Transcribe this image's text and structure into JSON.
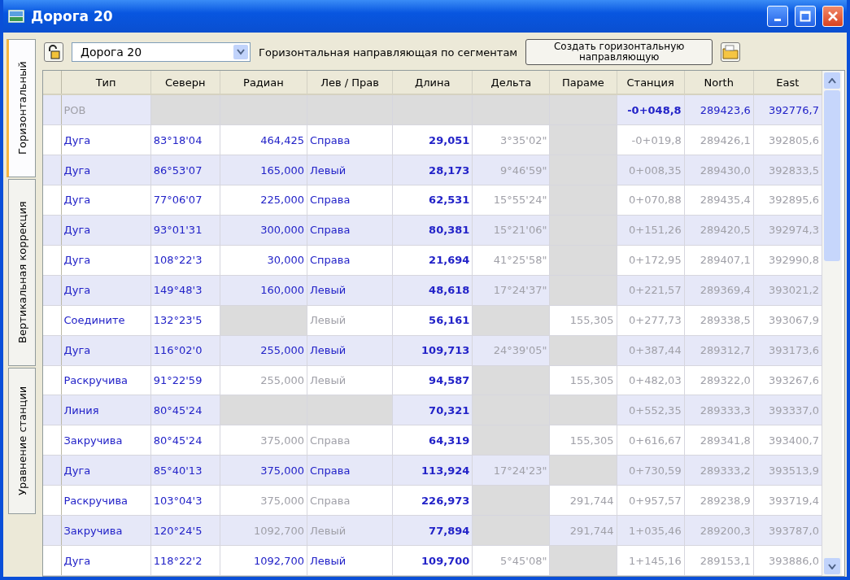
{
  "window": {
    "title": "Дорога 20"
  },
  "side_tabs": [
    {
      "label": "Горизонтальный",
      "selected": true
    },
    {
      "label": "Вертикальная коррекция",
      "selected": false
    },
    {
      "label": "Уравнение станции",
      "selected": false
    }
  ],
  "toolbar": {
    "alignment": {
      "value": "Дорога 20"
    },
    "label": "Горизонтальная направляющая по сегментам",
    "create_button": "Создать горизонтальную направляющую"
  },
  "table": {
    "columns": [
      {
        "label": "Тип"
      },
      {
        "label": "Северн"
      },
      {
        "label": "Радиан"
      },
      {
        "label": "Лев / Прав"
      },
      {
        "label": "Длина"
      },
      {
        "label": "Дельта"
      },
      {
        "label": "Параме"
      },
      {
        "label": "Станция"
      },
      {
        "label": "North"
      },
      {
        "label": "East"
      }
    ],
    "rows": [
      [
        {
          "text": "РОВ",
          "kind": "output"
        },
        {
          "kind": "blank"
        },
        {
          "kind": "blank"
        },
        {
          "kind": "blank"
        },
        {
          "kind": "blank"
        },
        {
          "kind": "blank"
        },
        {
          "kind": "blank"
        },
        {
          "text": "-0+048,8",
          "kind": "input"
        },
        {
          "text": "289423,6",
          "kind": "input"
        },
        {
          "text": "392776,7",
          "kind": "input"
        }
      ],
      [
        {
          "text": "Дуга",
          "kind": "input"
        },
        {
          "text": "83°18'04",
          "kind": "input"
        },
        {
          "text": "464,425",
          "kind": "input"
        },
        {
          "text": "Справа",
          "kind": "input"
        },
        {
          "text": "29,051",
          "kind": "input"
        },
        {
          "text": "3°35'02\"",
          "kind": "output"
        },
        {
          "kind": "blank"
        },
        {
          "text": "-0+019,8",
          "kind": "output"
        },
        {
          "text": "289426,1",
          "kind": "output"
        },
        {
          "text": "392805,6",
          "kind": "output"
        }
      ],
      [
        {
          "text": "Дуга",
          "kind": "input"
        },
        {
          "text": "86°53'07",
          "kind": "input"
        },
        {
          "text": "165,000",
          "kind": "input"
        },
        {
          "text": "Левый",
          "kind": "input"
        },
        {
          "text": "28,173",
          "kind": "input"
        },
        {
          "text": "9°46'59\"",
          "kind": "output"
        },
        {
          "kind": "blank"
        },
        {
          "text": "0+008,35",
          "kind": "output"
        },
        {
          "text": "289430,0",
          "kind": "output"
        },
        {
          "text": "392833,5",
          "kind": "output"
        }
      ],
      [
        {
          "text": "Дуга",
          "kind": "input"
        },
        {
          "text": "77°06'07",
          "kind": "input"
        },
        {
          "text": "225,000",
          "kind": "input"
        },
        {
          "text": "Справа",
          "kind": "input"
        },
        {
          "text": "62,531",
          "kind": "input"
        },
        {
          "text": "15°55'24\"",
          "kind": "output"
        },
        {
          "kind": "blank"
        },
        {
          "text": "0+070,88",
          "kind": "output"
        },
        {
          "text": "289435,4",
          "kind": "output"
        },
        {
          "text": "392895,6",
          "kind": "output"
        }
      ],
      [
        {
          "text": "Дуга",
          "kind": "input"
        },
        {
          "text": "93°01'31",
          "kind": "input"
        },
        {
          "text": "300,000",
          "kind": "input"
        },
        {
          "text": "Справа",
          "kind": "input"
        },
        {
          "text": "80,381",
          "kind": "input"
        },
        {
          "text": "15°21'06\"",
          "kind": "output"
        },
        {
          "kind": "blank"
        },
        {
          "text": "0+151,26",
          "kind": "output"
        },
        {
          "text": "289420,5",
          "kind": "output"
        },
        {
          "text": "392974,3",
          "kind": "output"
        }
      ],
      [
        {
          "text": "Дуга",
          "kind": "input"
        },
        {
          "text": "108°22'3",
          "kind": "input"
        },
        {
          "text": "30,000",
          "kind": "input"
        },
        {
          "text": "Справа",
          "kind": "input"
        },
        {
          "text": "21,694",
          "kind": "input"
        },
        {
          "text": "41°25'58\"",
          "kind": "output"
        },
        {
          "kind": "blank"
        },
        {
          "text": "0+172,95",
          "kind": "output"
        },
        {
          "text": "289407,1",
          "kind": "output"
        },
        {
          "text": "392990,8",
          "kind": "output"
        }
      ],
      [
        {
          "text": "Дуга",
          "kind": "input"
        },
        {
          "text": "149°48'3",
          "kind": "input"
        },
        {
          "text": "160,000",
          "kind": "input"
        },
        {
          "text": "Левый",
          "kind": "input"
        },
        {
          "text": "48,618",
          "kind": "input"
        },
        {
          "text": "17°24'37\"",
          "kind": "output"
        },
        {
          "kind": "blank"
        },
        {
          "text": "0+221,57",
          "kind": "output"
        },
        {
          "text": "289369,4",
          "kind": "output"
        },
        {
          "text": "393021,2",
          "kind": "output"
        }
      ],
      [
        {
          "text": "Соедините",
          "kind": "input"
        },
        {
          "text": "132°23'5",
          "kind": "input"
        },
        {
          "kind": "blank"
        },
        {
          "text": "Левый",
          "kind": "output"
        },
        {
          "text": "56,161",
          "kind": "input"
        },
        {
          "kind": "blank"
        },
        {
          "text": "155,305",
          "kind": "output"
        },
        {
          "text": "0+277,73",
          "kind": "output"
        },
        {
          "text": "289338,5",
          "kind": "output"
        },
        {
          "text": "393067,9",
          "kind": "output"
        }
      ],
      [
        {
          "text": "Дуга",
          "kind": "input"
        },
        {
          "text": "116°02'0",
          "kind": "input"
        },
        {
          "text": "255,000",
          "kind": "input"
        },
        {
          "text": "Левый",
          "kind": "input"
        },
        {
          "text": "109,713",
          "kind": "input"
        },
        {
          "text": "24°39'05\"",
          "kind": "output"
        },
        {
          "kind": "blank"
        },
        {
          "text": "0+387,44",
          "kind": "output"
        },
        {
          "text": "289312,7",
          "kind": "output"
        },
        {
          "text": "393173,6",
          "kind": "output"
        }
      ],
      [
        {
          "text": "Раскручива",
          "kind": "input"
        },
        {
          "text": "91°22'59",
          "kind": "input"
        },
        {
          "text": "255,000",
          "kind": "output"
        },
        {
          "text": "Левый",
          "kind": "output"
        },
        {
          "text": "94,587",
          "kind": "input"
        },
        {
          "kind": "blank"
        },
        {
          "text": "155,305",
          "kind": "output"
        },
        {
          "text": "0+482,03",
          "kind": "output"
        },
        {
          "text": "289322,0",
          "kind": "output"
        },
        {
          "text": "393267,6",
          "kind": "output"
        }
      ],
      [
        {
          "text": "Линия",
          "kind": "input"
        },
        {
          "text": "80°45'24",
          "kind": "input"
        },
        {
          "kind": "blank"
        },
        {
          "kind": "blank"
        },
        {
          "text": "70,321",
          "kind": "input"
        },
        {
          "kind": "blank"
        },
        {
          "kind": "blank"
        },
        {
          "text": "0+552,35",
          "kind": "output"
        },
        {
          "text": "289333,3",
          "kind": "output"
        },
        {
          "text": "393337,0",
          "kind": "output"
        }
      ],
      [
        {
          "text": "Закручива",
          "kind": "input"
        },
        {
          "text": "80°45'24",
          "kind": "input"
        },
        {
          "text": "375,000",
          "kind": "output"
        },
        {
          "text": "Справа",
          "kind": "output"
        },
        {
          "text": "64,319",
          "kind": "input"
        },
        {
          "kind": "blank"
        },
        {
          "text": "155,305",
          "kind": "output"
        },
        {
          "text": "0+616,67",
          "kind": "output"
        },
        {
          "text": "289341,8",
          "kind": "output"
        },
        {
          "text": "393400,7",
          "kind": "output"
        }
      ],
      [
        {
          "text": "Дуга",
          "kind": "input"
        },
        {
          "text": "85°40'13",
          "kind": "input"
        },
        {
          "text": "375,000",
          "kind": "input"
        },
        {
          "text": "Справа",
          "kind": "input"
        },
        {
          "text": "113,924",
          "kind": "input"
        },
        {
          "text": "17°24'23\"",
          "kind": "output"
        },
        {
          "kind": "blank"
        },
        {
          "text": "0+730,59",
          "kind": "output"
        },
        {
          "text": "289333,2",
          "kind": "output"
        },
        {
          "text": "393513,9",
          "kind": "output"
        }
      ],
      [
        {
          "text": "Раскручива",
          "kind": "input"
        },
        {
          "text": "103°04'3",
          "kind": "input"
        },
        {
          "text": "375,000",
          "kind": "output"
        },
        {
          "text": "Справа",
          "kind": "output"
        },
        {
          "text": "226,973",
          "kind": "input"
        },
        {
          "kind": "blank"
        },
        {
          "text": "291,744",
          "kind": "output"
        },
        {
          "text": "0+957,57",
          "kind": "output"
        },
        {
          "text": "289238,9",
          "kind": "output"
        },
        {
          "text": "393719,4",
          "kind": "output"
        }
      ],
      [
        {
          "text": "Закручива",
          "kind": "input"
        },
        {
          "text": "120°24'5",
          "kind": "input"
        },
        {
          "text": "1092,700",
          "kind": "output"
        },
        {
          "text": "Левый",
          "kind": "output"
        },
        {
          "text": "77,894",
          "kind": "input"
        },
        {
          "kind": "blank"
        },
        {
          "text": "291,744",
          "kind": "output"
        },
        {
          "text": "1+035,46",
          "kind": "output"
        },
        {
          "text": "289200,3",
          "kind": "output"
        },
        {
          "text": "393787,0",
          "kind": "output"
        }
      ],
      [
        {
          "text": "Дуга",
          "kind": "input"
        },
        {
          "text": "118°22'2",
          "kind": "input"
        },
        {
          "text": "1092,700",
          "kind": "input"
        },
        {
          "text": "Левый",
          "kind": "input"
        },
        {
          "text": "109,700",
          "kind": "input"
        },
        {
          "text": "5°45'08\"",
          "kind": "output"
        },
        {
          "kind": "blank"
        },
        {
          "text": "1+145,16",
          "kind": "output"
        },
        {
          "text": "289153,1",
          "kind": "output"
        },
        {
          "text": "393886,0",
          "kind": "output"
        }
      ]
    ]
  }
}
